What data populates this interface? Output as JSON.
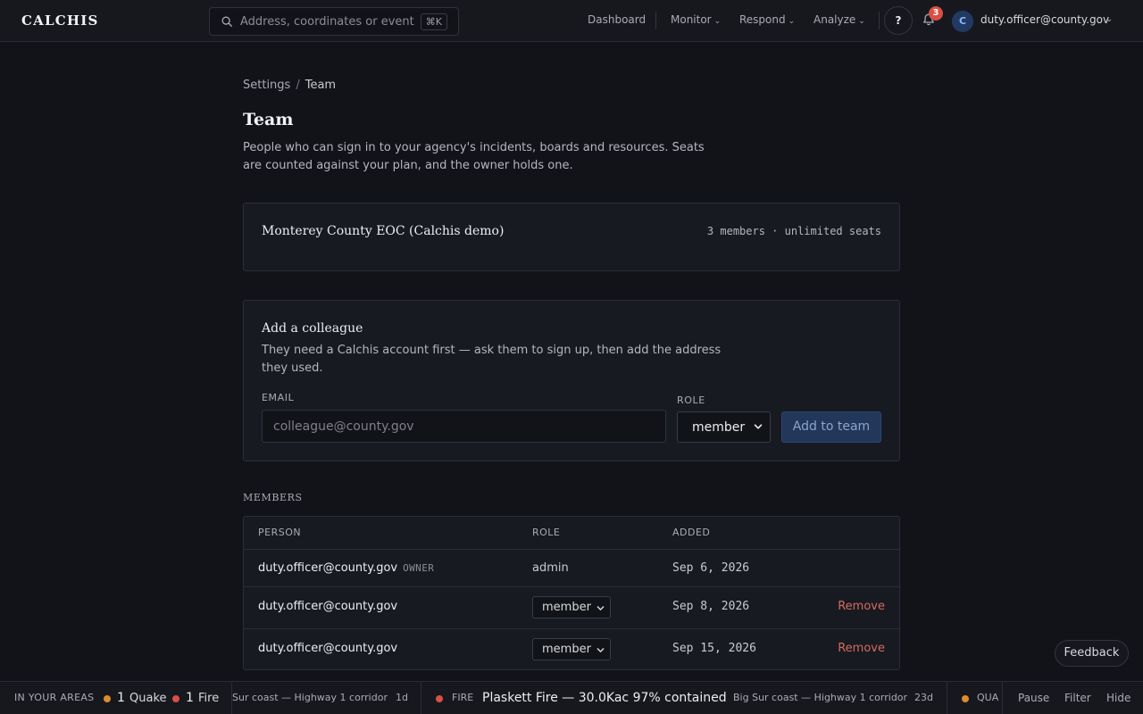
{
  "app": {
    "brand": "CALCHIS"
  },
  "search": {
    "placeholder": "Address, coordinates or event",
    "shortcut": "⌘K"
  },
  "nav": {
    "dashboard": "Dashboard",
    "monitor": "Monitor",
    "respond": "Respond",
    "analyze": "Analyze",
    "help": "?",
    "notifications_count": "3",
    "avatar_initial": "C",
    "user_email": "duty.officer@county.gov"
  },
  "breadcrumb": {
    "parent": "Settings",
    "separator": "/",
    "current": "Team"
  },
  "page": {
    "title": "Team",
    "description": "People who can sign in to your agency's incidents, boards and resources. Seats are counted against your plan, and the owner holds one."
  },
  "org": {
    "name": "Monterey County EOC (Calchis demo)",
    "meta": "3 members · unlimited seats"
  },
  "add_colleague": {
    "title": "Add a colleague",
    "description": "They need a Calchis account first — ask them to sign up, then add the address they used.",
    "email_label": "EMAIL",
    "email_placeholder": "colleague@county.gov",
    "role_label": "ROLE",
    "role_value": "member",
    "submit_label": "Add to team"
  },
  "members": {
    "section_label": "MEMBERS",
    "columns": {
      "person": "PERSON",
      "role": "ROLE",
      "added": "ADDED"
    },
    "rows": [
      {
        "person": "duty.officer@county.gov",
        "tag": "OWNER",
        "role": "admin",
        "added": "Sep 6, 2026",
        "action": ""
      },
      {
        "person": "duty.officer@county.gov",
        "tag": "",
        "role": "member",
        "added": "Sep 8, 2026",
        "action": "Remove"
      },
      {
        "person": "duty.officer@county.gov",
        "tag": "",
        "role": "member",
        "added": "Sep 15, 2026",
        "action": "Remove"
      }
    ]
  },
  "feedback": {
    "label": "Feedback"
  },
  "ticker": {
    "areas_label": "IN YOUR AREAS",
    "quake_count": "1",
    "quake_label": "Quake",
    "fire_count": "1",
    "fire_label": "Fire",
    "item1_location": "Sur coast — Highway 1 corridor",
    "item1_age": "1d",
    "item2_type": "FIRE",
    "item2_title": "Plaskett Fire — 30.0Kac 97% contained",
    "item2_location": "Big Sur coast — Highway 1 corridor",
    "item2_age": "23d",
    "item3_type": "QUA",
    "controls": {
      "pause": "Pause",
      "filter": "Filter",
      "hide": "Hide"
    },
    "colors": {
      "quake": "#e08a2e",
      "fire": "#d94f45"
    }
  }
}
